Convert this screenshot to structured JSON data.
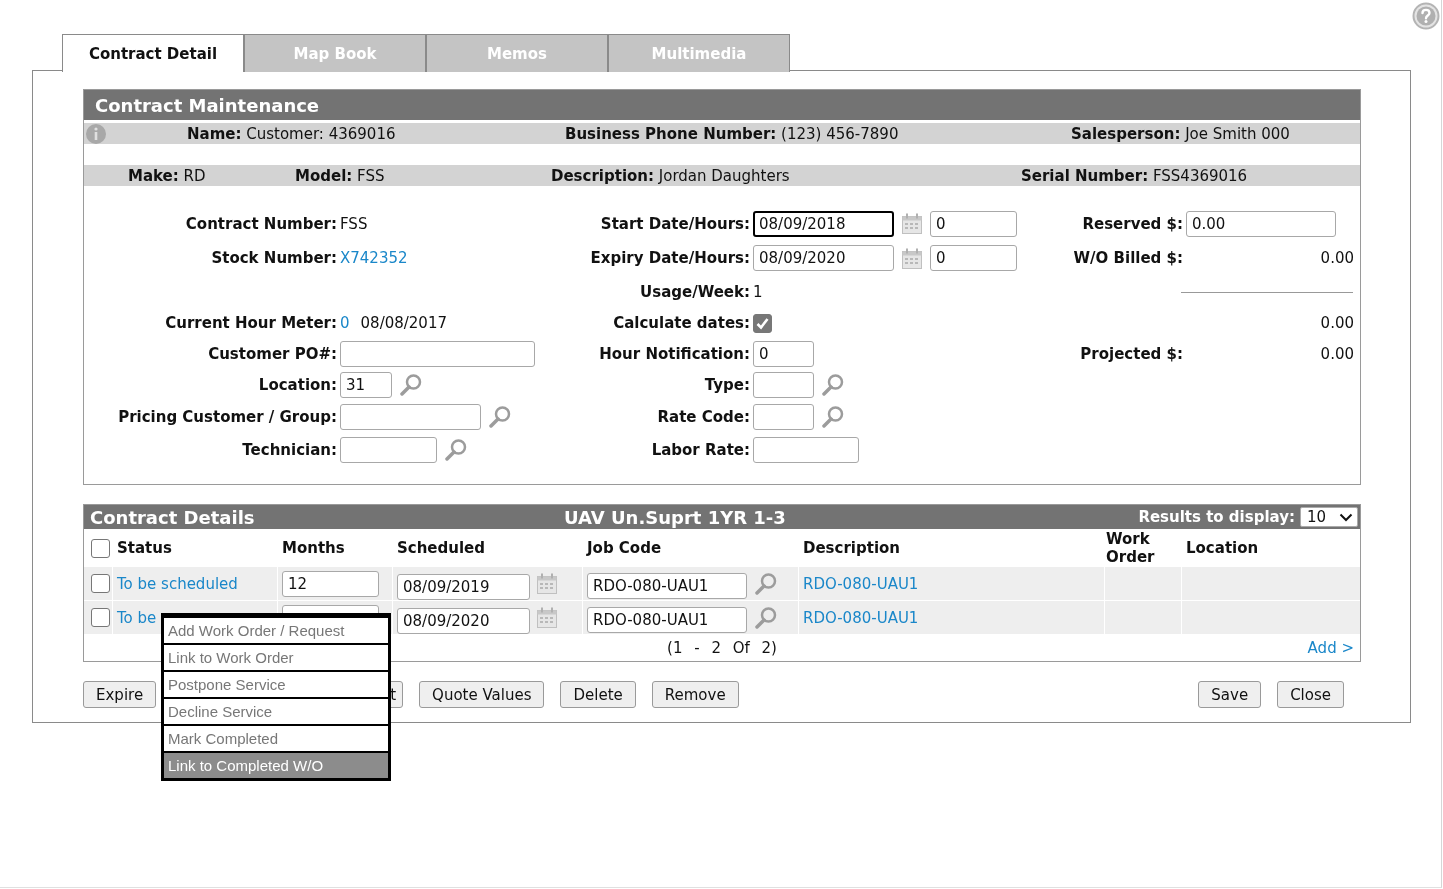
{
  "tabs": [
    {
      "label": "Contract Detail",
      "selected": true
    },
    {
      "label": "Map Book",
      "selected": false
    },
    {
      "label": "Memos",
      "selected": false
    },
    {
      "label": "Multimedia",
      "selected": false
    }
  ],
  "maintenance": {
    "title": "Contract Maintenance",
    "info_rows": [
      [
        {
          "label": "Name:",
          "value": "Customer: 4369016"
        },
        {
          "label": "Business Phone Number:",
          "value": "(123) 456-7890"
        },
        {
          "label": "Salesperson:",
          "value": "Joe Smith 000"
        }
      ],
      [
        {
          "label": "Make:",
          "value": "RD"
        },
        {
          "label": "Model:",
          "value": "FSS"
        },
        {
          "label": "Description:",
          "value": "Jordan Daughters"
        },
        {
          "label": "Serial Number:",
          "value": "FSS4369016"
        }
      ]
    ],
    "form_rows": [
      {
        "left": {
          "kind": "text",
          "label": "Contract Number:",
          "value": "FSS"
        },
        "middle": {
          "kind": "date_hours",
          "label": "Start Date/Hours:",
          "date": "08/09/2018",
          "hours": "0",
          "focused": true
        },
        "right": {
          "kind": "input",
          "label": "Reserved $:",
          "value": "0.00"
        }
      },
      {
        "left": {
          "kind": "link",
          "label": "Stock Number:",
          "value": "X742352"
        },
        "middle": {
          "kind": "date_hours",
          "label": "Expiry Date/Hours:",
          "date": "08/09/2020",
          "hours": "0",
          "focused": false
        },
        "right": {
          "kind": "amount",
          "label": "W/O Billed $:",
          "value": "0.00"
        }
      },
      {
        "middle": {
          "kind": "text",
          "label": "Usage/Week:",
          "value": "1"
        },
        "right": {
          "kind": "rule"
        }
      },
      {
        "left": {
          "kind": "meter",
          "label": "Current Hour Meter:",
          "link": "0",
          "date": "08/08/2017"
        },
        "middle": {
          "kind": "checkbox",
          "label": "Calculate dates:",
          "checked": true
        },
        "right": {
          "kind": "amount",
          "value": "0.00"
        }
      },
      {
        "left": {
          "kind": "input",
          "label": "Customer PO#:"
        },
        "middle": {
          "kind": "input",
          "label": "Hour Notification:",
          "value": "0"
        },
        "right": {
          "kind": "amount",
          "label": "Projected $:",
          "value": "0.00"
        }
      },
      {
        "left": {
          "kind": "lookup",
          "label": "Location:",
          "value": "31"
        },
        "middle": {
          "kind": "lookup",
          "label": "Type:"
        }
      },
      {
        "left": {
          "kind": "lookup",
          "label": "Pricing Customer / Group:"
        },
        "middle": {
          "kind": "lookup",
          "label": "Rate Code:"
        }
      },
      {
        "left": {
          "kind": "lookup",
          "label": "Technician:"
        },
        "middle": {
          "kind": "input",
          "label": "Labor Rate:"
        }
      }
    ]
  },
  "details": {
    "title": "Contract Details",
    "plan": "UAV Un.Suprt 1YR 1-3",
    "results_label": "Results to display:",
    "results_value": "10",
    "select_all_checked": false,
    "columns": [
      "Status",
      "Months",
      "Scheduled",
      "Job Code",
      "Description",
      "Work Order",
      "Location"
    ],
    "rows": [
      {
        "checked": false,
        "status": "To be scheduled",
        "months": "12",
        "scheduled": "08/09/2019",
        "job_code": "RDO-080-UAU1",
        "description": "RDO-080-UAU1"
      },
      {
        "checked": false,
        "status": "To be",
        "scheduled": "08/09/2020",
        "job_code": "RDO-080-UAU1",
        "description": "RDO-080-UAU1"
      }
    ],
    "pagination": "(1 - 2 Of 2)",
    "add_link": "Add >"
  },
  "buttons_left": [
    {
      "label": "Expire",
      "kind": "normal"
    },
    {
      "label": "t",
      "kind": "covered"
    },
    {
      "label": "Quote Values",
      "kind": "normal"
    },
    {
      "label": "Delete",
      "kind": "normal"
    },
    {
      "label": "Remove",
      "kind": "normal"
    }
  ],
  "buttons_right": [
    {
      "label": "Save",
      "kind": "normal"
    },
    {
      "label": "Close",
      "kind": "normal"
    }
  ],
  "menu": {
    "items": [
      {
        "label": "Add Work Order / Request",
        "selected": false
      },
      {
        "label": "Link to Work Order",
        "selected": false
      },
      {
        "label": "Postpone Service",
        "selected": false
      },
      {
        "label": "Decline Service",
        "selected": false
      },
      {
        "label": "Mark Completed",
        "selected": false
      },
      {
        "label": "Link to Completed W/O",
        "selected": true
      }
    ]
  }
}
